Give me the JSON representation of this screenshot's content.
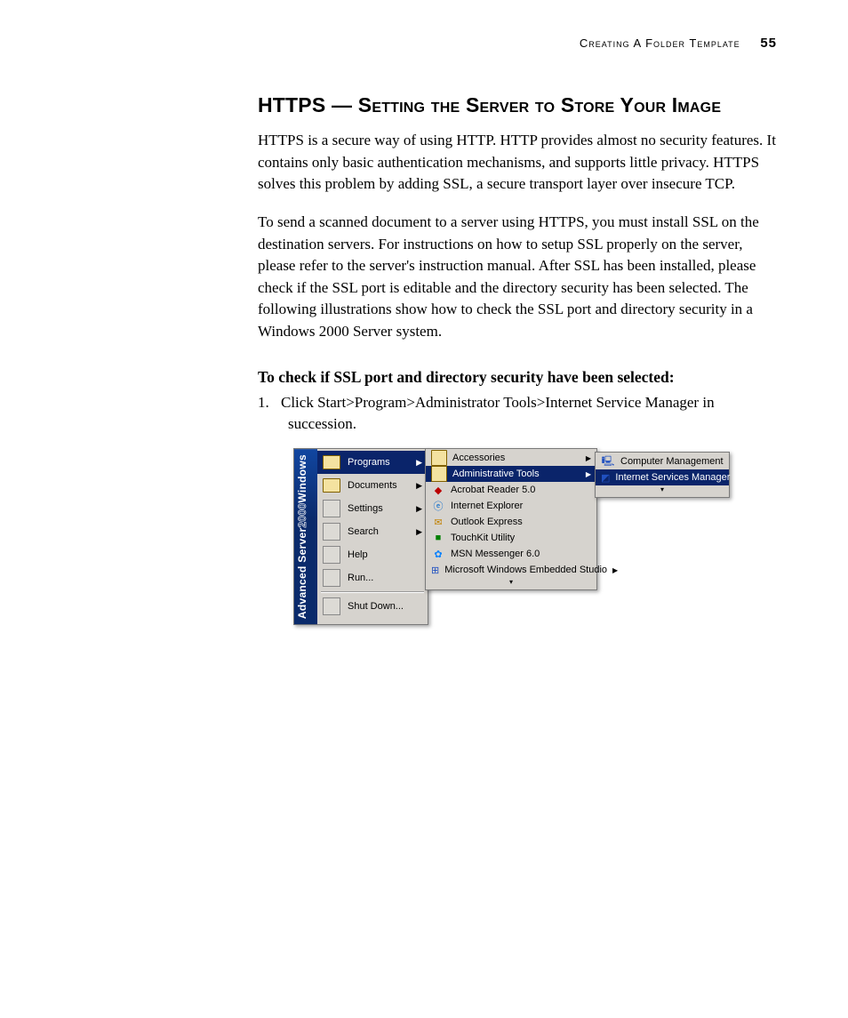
{
  "header": {
    "section": "Creating A Folder Template",
    "page": "55"
  },
  "title": {
    "lead": "HTTPS",
    "dash": " — ",
    "rest": "Setting the Server to Store Your Image"
  },
  "para1": "HTTPS is a secure way of using HTTP. HTTP provides almost no security features. It contains only basic authentication mechanisms, and supports little privacy. HTTPS solves this problem by adding SSL, a secure transport layer over insecure TCP.",
  "para2": "To send a scanned document to a server using HTTPS, you must install SSL on the destination servers. For instructions on how to setup SSL properly on the server, please refer to the server's instruction manual. After SSL has been installed, please check if the SSL port is editable and the directory security has been selected. The following illustrations show how to check the SSL port and directory security in a Windows 2000 Server system.",
  "subheading": "To check if SSL port and directory security have been selected:",
  "step1": {
    "num": "1.",
    "text": "Click Start>Program>Administrator Tools>Internet Service Manager in succession."
  },
  "startmenu": {
    "sidebar": {
      "brand1": "Windows",
      "brand2": "2000",
      "brand3": " Advanced Server"
    },
    "items": [
      {
        "label": "Programs",
        "hasSub": true,
        "selected": true
      },
      {
        "label": "Documents",
        "hasSub": true
      },
      {
        "label": "Settings",
        "hasSub": true
      },
      {
        "label": "Search",
        "hasSub": true
      },
      {
        "label": "Help",
        "hasSub": false
      },
      {
        "label": "Run...",
        "hasSub": false
      },
      {
        "label": "Shut Down...",
        "hasSub": false
      }
    ],
    "programs": [
      {
        "label": "Accessories",
        "hasSub": true
      },
      {
        "label": "Administrative Tools",
        "hasSub": true,
        "selected": true
      },
      {
        "label": "Acrobat Reader 5.0"
      },
      {
        "label": "Internet Explorer"
      },
      {
        "label": "Outlook Express"
      },
      {
        "label": "TouchKit Utility"
      },
      {
        "label": "MSN Messenger 6.0"
      },
      {
        "label": "Microsoft Windows Embedded Studio",
        "hasSub": true
      }
    ],
    "admintools": [
      {
        "label": "Computer Management"
      },
      {
        "label": "Internet Services Manager",
        "selected": true
      }
    ]
  }
}
